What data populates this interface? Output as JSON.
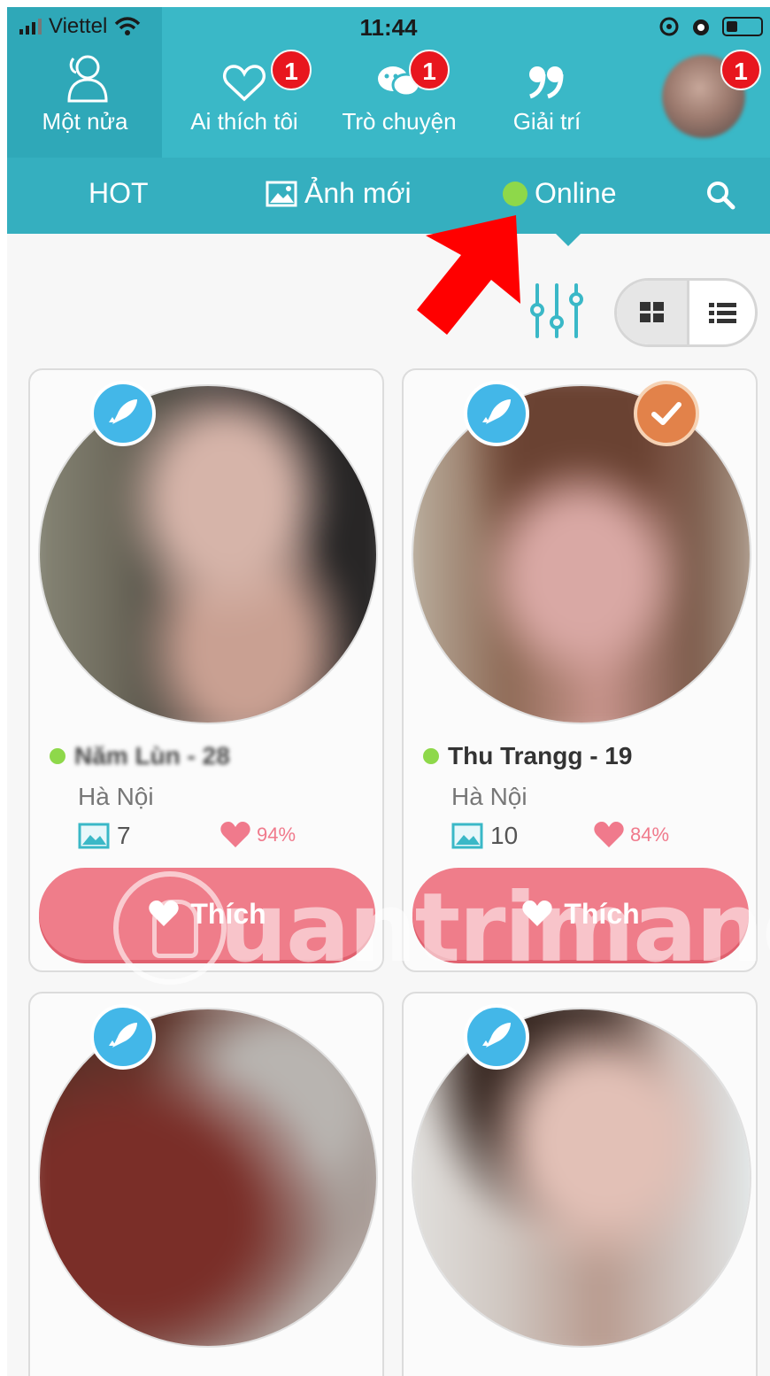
{
  "status_bar": {
    "carrier": "Viettel",
    "time": "11:44"
  },
  "top_nav": {
    "items": [
      {
        "label": "Một nửa",
        "icon": "people-icon"
      },
      {
        "label": "Ai thích tôi",
        "icon": "heart-outline-icon",
        "badge": "1"
      },
      {
        "label": "Trò chuyện",
        "icon": "chat-bubbles-icon",
        "badge": "1"
      },
      {
        "label": "Giải trí",
        "icon": "quote-icon"
      }
    ],
    "profile_badge": "1"
  },
  "sub_tabs": {
    "hot": "HOT",
    "new_photos": "Ảnh mới",
    "online": "Online"
  },
  "cards": [
    {
      "name": "Năm Lùn - 28",
      "city": "Hà Nội",
      "photos": "7",
      "percent": "94%",
      "like_label": "Thích",
      "online": true,
      "verified": false
    },
    {
      "name": "Thu Trangg - 19",
      "city": "Hà Nội",
      "photos": "10",
      "percent": "84%",
      "like_label": "Thích",
      "online": true,
      "verified": true
    },
    {
      "name": "",
      "city": "",
      "photos": "",
      "percent": "",
      "like_label": "",
      "online": true,
      "verified": false
    },
    {
      "name": "",
      "city": "",
      "photos": "",
      "percent": "",
      "like_label": "",
      "online": true,
      "verified": false
    }
  ],
  "watermark": "uantrimang",
  "colors": {
    "teal": "#3ab8c7",
    "like": "#ef7d8a",
    "online": "#8ed84a",
    "badge": "#e8161e",
    "annotation_arrow": "#ff0000"
  }
}
